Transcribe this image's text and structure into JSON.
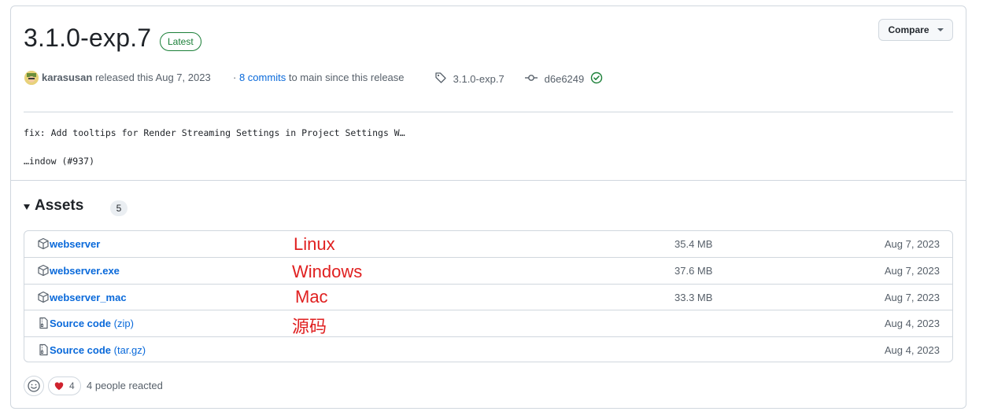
{
  "release": {
    "title": "3.1.0-exp.7",
    "badge": "Latest",
    "compare_label": "Compare",
    "author": "karasusan",
    "released_text": "released this Aug 7, 2023",
    "dot": "·",
    "commits_link": "8 commits",
    "commits_suffix": "to main since this release",
    "tag": "3.1.0-exp.7",
    "commit_hash": "d6e6249"
  },
  "body": {
    "line1": "fix: Add tooltips for Render Streaming Settings in Project Settings W…",
    "line2": "…indow (#937)"
  },
  "assets": {
    "title": "Assets",
    "count": "5",
    "items": [
      {
        "icon": "package-icon",
        "name": "webserver",
        "ext": "",
        "size": "35.4 MB",
        "date": "Aug 7, 2023",
        "annotation": "Linux"
      },
      {
        "icon": "package-icon",
        "name": "webserver.exe",
        "ext": "",
        "size": "37.6 MB",
        "date": "Aug 7, 2023",
        "annotation": "Windows"
      },
      {
        "icon": "package-icon",
        "name": "webserver_mac",
        "ext": "",
        "size": "33.3 MB",
        "date": "Aug 7, 2023",
        "annotation": "Mac"
      },
      {
        "icon": "file-zip-icon",
        "name": "Source code",
        "ext": "(zip)",
        "size": "",
        "date": "Aug 4, 2023",
        "annotation": "源码"
      },
      {
        "icon": "file-zip-icon",
        "name": "Source code",
        "ext": "(tar.gz)",
        "size": "",
        "date": "Aug 4, 2023",
        "annotation": ""
      }
    ]
  },
  "reactions": {
    "heart_count": "4",
    "summary": "4 people reacted"
  },
  "colors": {
    "link": "#0969da",
    "success": "#1a7f37",
    "annotation": "#e02020",
    "border": "#d0d7de"
  }
}
